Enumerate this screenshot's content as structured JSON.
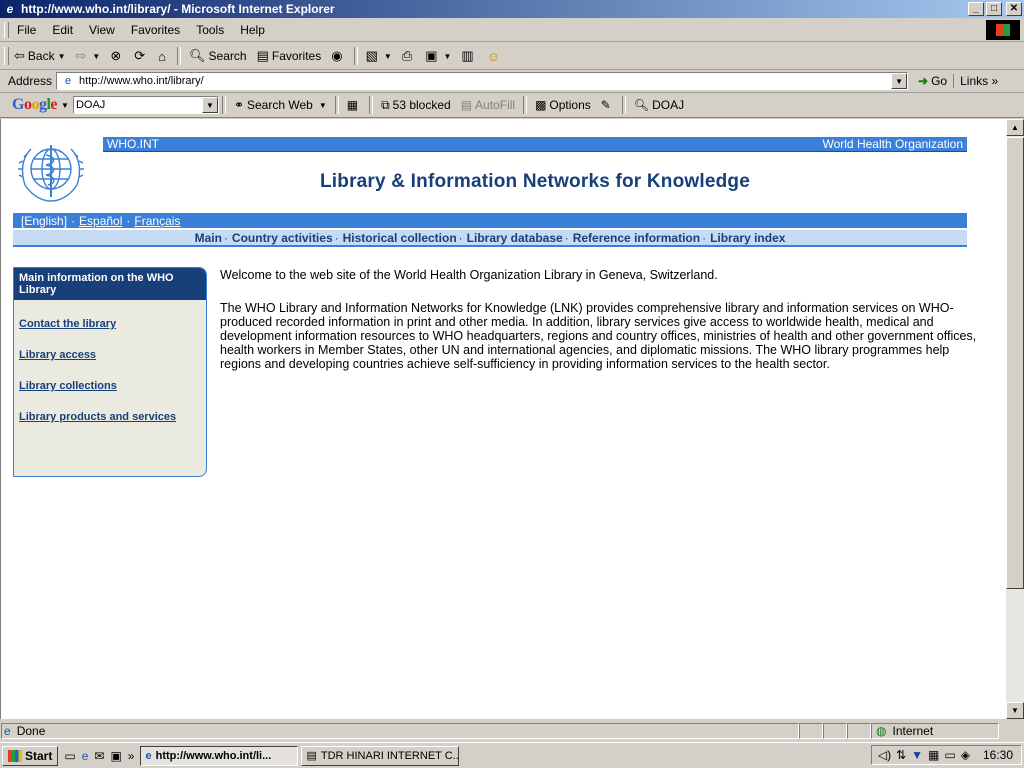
{
  "window": {
    "title": "http://www.who.int/library/ - Microsoft Internet Explorer",
    "minimize": "_",
    "maximize": "□",
    "close": "✕"
  },
  "menu": [
    "File",
    "Edit",
    "View",
    "Favorites",
    "Tools",
    "Help"
  ],
  "toolbar": {
    "back": "Back",
    "search": "Search",
    "favorites": "Favorites"
  },
  "address": {
    "label": "Address",
    "url": "http://www.who.int/library/",
    "go": "Go",
    "links": "Links"
  },
  "google": {
    "logo": "Google",
    "query": "DOAJ",
    "search_web": "Search Web",
    "blocked": "53 blocked",
    "autofill": "AutoFill",
    "options": "Options",
    "doaj_button": "DOAJ"
  },
  "page": {
    "top_left": "WHO.INT",
    "top_right": "World Health Organization",
    "site_title": "Library & Information Networks for Knowledge",
    "languages": {
      "current": "[English]",
      "spanish": "Español",
      "french": "Français"
    },
    "nav": [
      "Main",
      "Country activities",
      "Historical collection",
      "Library database",
      "Reference information",
      "Library index"
    ],
    "sidebar": {
      "heading": "Main information on the WHO Library",
      "links": [
        "Contact the library",
        "Library access",
        "Library collections",
        "Library products and services"
      ]
    },
    "welcome": "Welcome to the web site of the World Health Organization Library in Geneva, Switzerland.",
    "description": "The WHO Library and Information Networks for Knowledge (LNK) provides comprehensive library and information services on WHO-produced recorded information in print and other media. In addition, library services give access to worldwide health, medical and development information resources to WHO headquarters, regions and country offices, ministries of health and other government offices, health workers in Member States, other UN and international agencies, and diplomatic missions. The WHO library programmes help regions and developing countries achieve self-sufficiency in providing information services to the health sector."
  },
  "status": {
    "text": "Done",
    "zone": "Internet"
  },
  "taskbar": {
    "start": "Start",
    "task1": "http://www.who.int/li...",
    "task2": "TDR HINARI INTERNET C...",
    "clock": "16:30"
  },
  "colors": {
    "who_blue": "#3a80d8",
    "who_navy": "#173f7a",
    "nav_bg": "#c5daf3",
    "sidebar_bg": "#ebeae1"
  }
}
